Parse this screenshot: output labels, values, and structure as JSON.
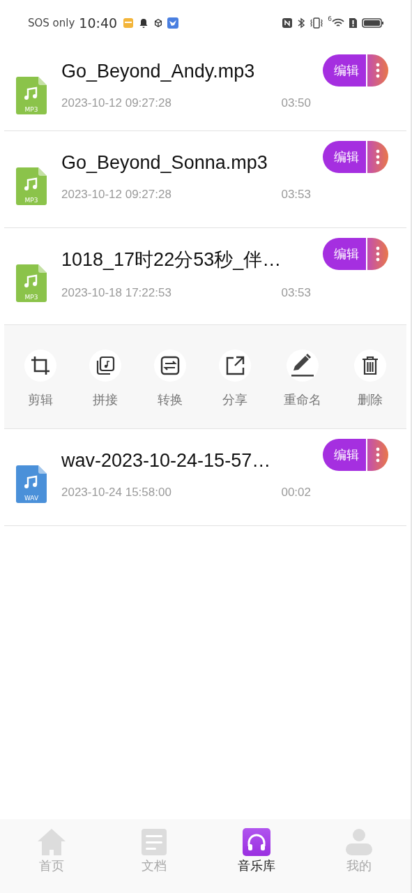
{
  "status_bar": {
    "carrier": "SOS only",
    "time": "10:40",
    "wifi_label": "6"
  },
  "files": [
    {
      "kind": "mp3",
      "badge": "MP3",
      "name": "Go_Beyond_Andy.mp3",
      "date": "2023-10-12 09:27:28",
      "duration": "03:50",
      "edit_label": "编辑"
    },
    {
      "kind": "mp3",
      "badge": "MP3",
      "name": "Go_Beyond_Sonna.mp3",
      "date": "2023-10-12 09:27:28",
      "duration": "03:53",
      "edit_label": "编辑"
    },
    {
      "kind": "mp3",
      "badge": "MP3",
      "name": "1018_17时22分53秒_伴…",
      "date": "2023-10-18 17:22:53",
      "duration": "03:53",
      "edit_label": "编辑",
      "actions": [
        {
          "kind": "crop",
          "label": "剪辑"
        },
        {
          "kind": "merge",
          "label": "拼接"
        },
        {
          "kind": "convert",
          "label": "转换"
        },
        {
          "kind": "share",
          "label": "分享"
        },
        {
          "kind": "rename",
          "label": "重命名"
        },
        {
          "kind": "delete",
          "label": "删除"
        }
      ]
    },
    {
      "kind": "wav",
      "badge": "WAV",
      "name": "wav-2023-10-24-15-57…",
      "date": "2023-10-24 15:58:00",
      "duration": "00:02",
      "edit_label": "编辑"
    }
  ],
  "bottom_nav": [
    {
      "kind": "home",
      "label": "首页",
      "selected": false
    },
    {
      "kind": "document",
      "label": "文档",
      "selected": false
    },
    {
      "kind": "music",
      "label": "音乐库",
      "selected": true
    },
    {
      "kind": "person",
      "label": "我的",
      "selected": false
    }
  ]
}
